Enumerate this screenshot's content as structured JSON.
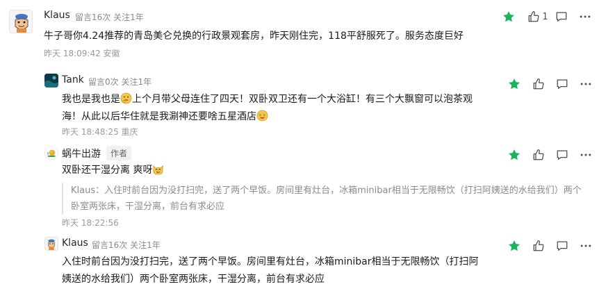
{
  "colors": {
    "accent_green": "#19b45b",
    "meta_gray": "#8a8a8a"
  },
  "comments": [
    {
      "author": "Klaus",
      "stats": "留言16次 关注1年",
      "text": "牛子哥你4.24推荐的青岛美仑兑换的行政景观套房，昨天刚住完，118平舒服死了。服务态度巨好",
      "time": "昨天 18:09:42 安徽",
      "like_count": "1",
      "starred": true
    },
    {
      "author": "Tank",
      "stats": "留言0次 关注1年",
      "text_part1": "我也是我也是",
      "text_part2": "上个月带父母连住了四天！双卧双卫还有一个大浴缸！有三个大飘窗可以泡茶观",
      "text_line2": "海！从此以后华住就是我涮神还要啥五星酒店",
      "time": "昨天 18:48:25 重庆",
      "starred": true
    },
    {
      "author": "蜗牛出游",
      "tag": "作者",
      "text": "双卧还干湿分离 爽呀",
      "quote": "Klaus：入住时前台因为没打扫完，送了两个早饭。房间里有灶台，冰箱minibar相当于无限畅饮（打扫阿姨送的水给我们）两个卧室两张床，干湿分离，前台有求必应",
      "time": "昨天 18:22:56",
      "starred": true
    },
    {
      "author": "Klaus",
      "stats": "留言16次 关注1年",
      "text": "入住时前台因为没打扫完，送了两个早饭。房间里有灶台，冰箱minibar相当于无限畅饮（打扫阿姨送的水给我们）两个卧室两张床，干湿分离，前台有求必应",
      "starred": true
    }
  ],
  "icons": {
    "star": "star-icon",
    "like": "thumbs-up-icon",
    "reply": "comment-bubble-icon",
    "more": "more-dots-icon"
  }
}
